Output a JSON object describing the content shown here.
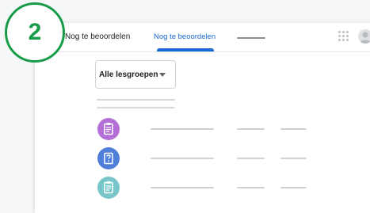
{
  "step_badge": {
    "number": "2",
    "color": "#189c48"
  },
  "header": {
    "app_title": "Nog te beoordelen",
    "active_tab": "Nog te beoordelen",
    "accent_color": "#1967d2",
    "icons": [
      "apps-grid-icon",
      "account-avatar-icon"
    ]
  },
  "filter": {
    "selected": "Alle lesgroepen",
    "icon": "dropdown-arrow-icon"
  },
  "assignments": [
    {
      "icon": "assignment-icon",
      "color": "#b46fd6"
    },
    {
      "icon": "question-icon",
      "color": "#4f7fd8"
    },
    {
      "icon": "material-icon",
      "color": "#78c6c9"
    }
  ]
}
